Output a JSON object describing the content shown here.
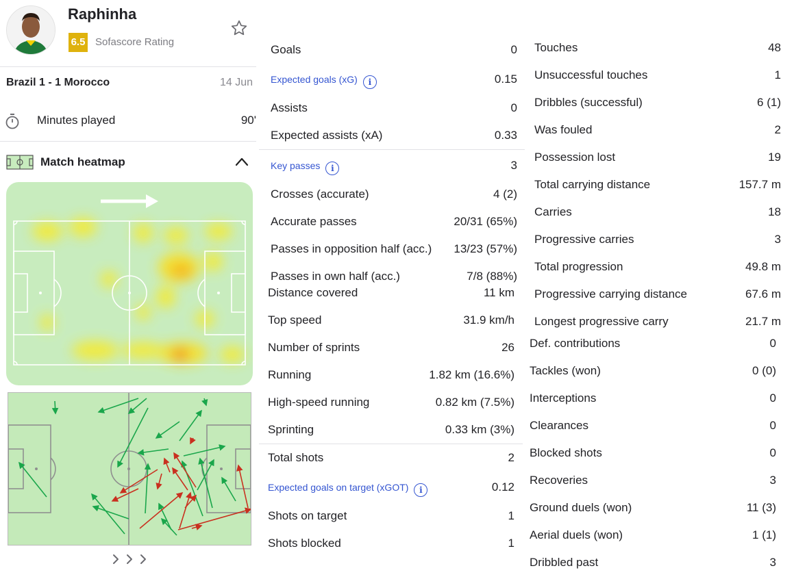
{
  "player": {
    "name": "Raphinha",
    "rating": "6.5",
    "rating_label": "Sofascore Rating"
  },
  "match": {
    "teams": "Brazil 1 - 1 Morocco",
    "date": "14 Jun"
  },
  "minutes": {
    "label": "Minutes played",
    "value": "90'"
  },
  "heatmap": {
    "title": "Match heatmap"
  },
  "colors": {
    "rating": "#dfb20d",
    "pitch": "#c8ecbe",
    "link": "#3455d1",
    "pass_ok": "#1aa64b",
    "pass_fail": "#c9301f"
  },
  "attack": [
    {
      "label": "Goals",
      "value": "0"
    },
    {
      "label": "Expected goals (xG)",
      "value": "0.15",
      "info": true
    },
    {
      "label": "Assists",
      "value": "0"
    },
    {
      "label": "Expected assists (xA)",
      "value": "0.33"
    }
  ],
  "passing": [
    {
      "label": "Key passes",
      "value": "3",
      "info": true
    },
    {
      "label": "Crosses (accurate)",
      "value": "4 (2)"
    },
    {
      "label": "Accurate passes",
      "value": "20/31 (65%)"
    },
    {
      "label": "Passes in opposition half (acc.)",
      "value": "13/23 (57%)"
    },
    {
      "label": "Passes in own half (acc.)",
      "value": "7/8 (88%)"
    }
  ],
  "physical": [
    {
      "label": "Distance covered",
      "value": "11 km"
    },
    {
      "label": "Top speed",
      "value": "31.9 km/h"
    },
    {
      "label": "Number of sprints",
      "value": "26"
    },
    {
      "label": "Running",
      "value": "1.82 km (16.6%)"
    },
    {
      "label": "High-speed running",
      "value": "0.82 km (7.5%)"
    },
    {
      "label": "Sprinting",
      "value": "0.33 km (3%)"
    }
  ],
  "shooting": [
    {
      "label": "Total shots",
      "value": "2"
    },
    {
      "label": "Expected goals on target (xGOT)",
      "value": "0.12",
      "info": true
    },
    {
      "label": "Shots on target",
      "value": "1"
    },
    {
      "label": "Shots blocked",
      "value": "1"
    }
  ],
  "possession": [
    {
      "label": "Touches",
      "value": "48"
    },
    {
      "label": "Unsuccessful touches",
      "value": "1"
    },
    {
      "label": "Dribbles (successful)",
      "value": "6 (1)"
    },
    {
      "label": "Was fouled",
      "value": "2"
    },
    {
      "label": "Possession lost",
      "value": "19"
    },
    {
      "label": "Total carrying distance",
      "value": "157.7 m"
    },
    {
      "label": "Carries",
      "value": "18"
    },
    {
      "label": "Progressive carries",
      "value": "3"
    },
    {
      "label": "Total progression",
      "value": "49.8 m"
    },
    {
      "label": "Progressive carrying distance",
      "value": "67.6 m"
    },
    {
      "label": "Longest progressive carry",
      "value": "21.7 m"
    }
  ],
  "defence": [
    {
      "label": "Def. contributions",
      "value": "0"
    },
    {
      "label": "Tackles (won)",
      "value": "0 (0)"
    },
    {
      "label": "Interceptions",
      "value": "0"
    },
    {
      "label": "Clearances",
      "value": "0"
    },
    {
      "label": "Blocked shots",
      "value": "0"
    },
    {
      "label": "Recoveries",
      "value": "3"
    },
    {
      "label": "Ground duels (won)",
      "value": "11 (3)"
    },
    {
      "label": "Aerial duels (won)",
      "value": "1 (1)"
    },
    {
      "label": "Dribbled past",
      "value": "3"
    }
  ]
}
